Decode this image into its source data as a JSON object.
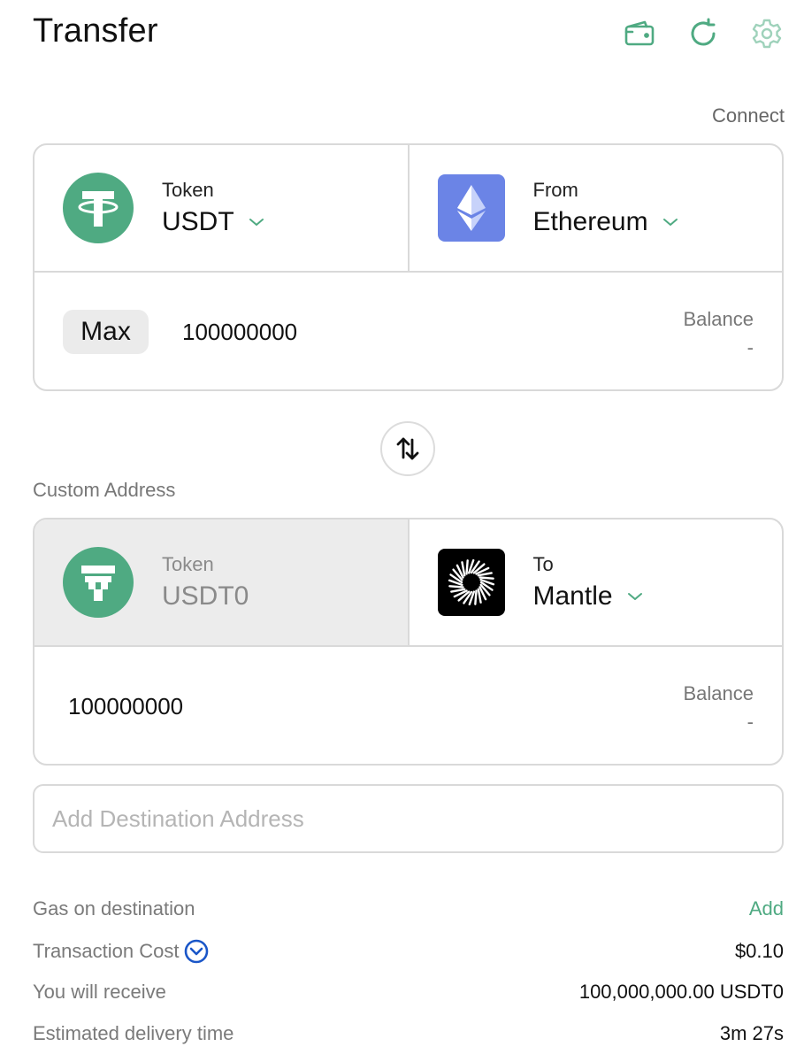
{
  "header": {
    "title": "Transfer",
    "icons": [
      "wallet-icon",
      "refresh-icon",
      "settings-icon"
    ],
    "accent_color": "#4faa82"
  },
  "connect_label": "Connect",
  "source": {
    "token_label": "Token",
    "token_value": "USDT",
    "chain_label": "From",
    "chain_value": "Ethereum",
    "max_label": "Max",
    "amount": "100000000",
    "balance_label": "Balance",
    "balance_value": "-"
  },
  "custom_address_label": "Custom Address",
  "destination": {
    "token_label": "Token",
    "token_value": "USDT0",
    "chain_label": "To",
    "chain_value": "Mantle",
    "amount": "100000000",
    "balance_label": "Balance",
    "balance_value": "-"
  },
  "destination_address": {
    "placeholder": "Add Destination Address",
    "value": ""
  },
  "summary": {
    "gas_label": "Gas on destination",
    "gas_action": "Add",
    "cost_label": "Transaction Cost",
    "cost_value": "$0.10",
    "receive_label": "You will receive",
    "receive_value": "100,000,000.00 USDT0",
    "delivery_label": "Estimated delivery time",
    "delivery_value": "3m 27s"
  }
}
